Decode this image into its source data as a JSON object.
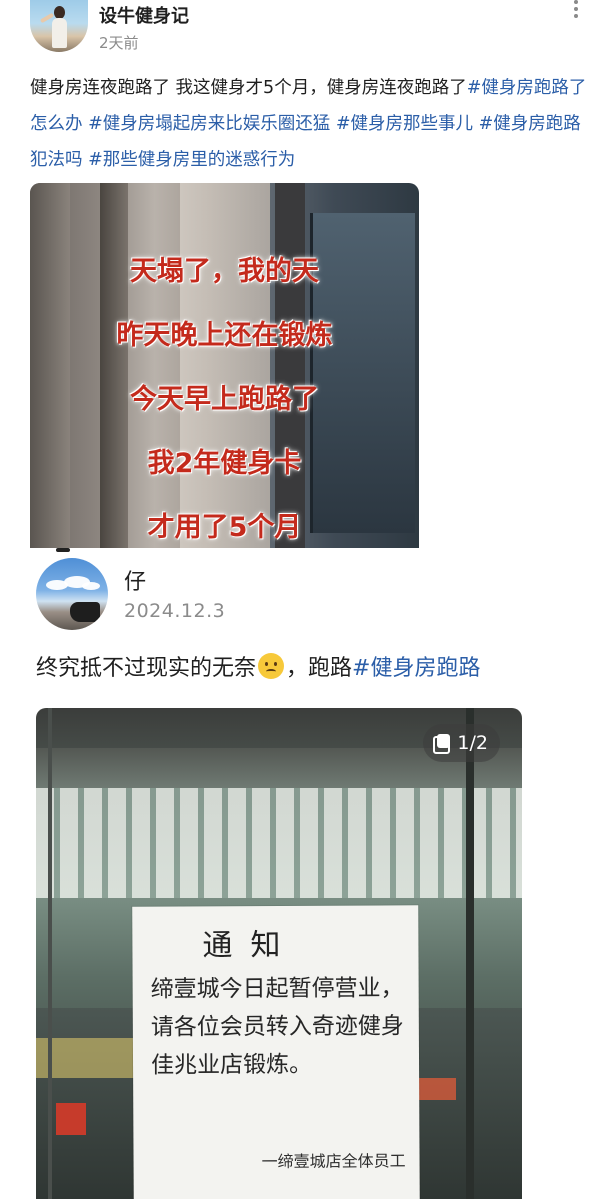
{
  "post1": {
    "username": "设牛健身记",
    "time": "2天前",
    "text_plain": "健身房连夜跑路了 我这健身才5个月，健身房连夜跑路了",
    "hashtags": [
      "#健身房跑路了怎么办",
      "#健身房塌起房来比娱乐圈还猛",
      "#健身房那些事儿",
      "#健身房跑路犯法吗",
      "#那些健身房里的迷惑行为"
    ],
    "image_overlay": [
      "天塌了，我的天",
      "昨天晚上还在锻炼",
      "今天早上跑路了",
      "我2年健身卡",
      "才用了5个月"
    ]
  },
  "post2": {
    "username": "仔",
    "time": "2024.12.3",
    "text_plain": "终究抵不过现实的无奈",
    "emoji": "worried-face",
    "text_after": "，跑路",
    "hashtag": "#健身房跑路",
    "pager": "1/2",
    "notice": {
      "title": "通知",
      "body": "缔壹城今日起暂停营业，请各位会员转入奇迹健身佳兆业店锻炼。",
      "sign": "一缔壹城店全体员工"
    }
  }
}
